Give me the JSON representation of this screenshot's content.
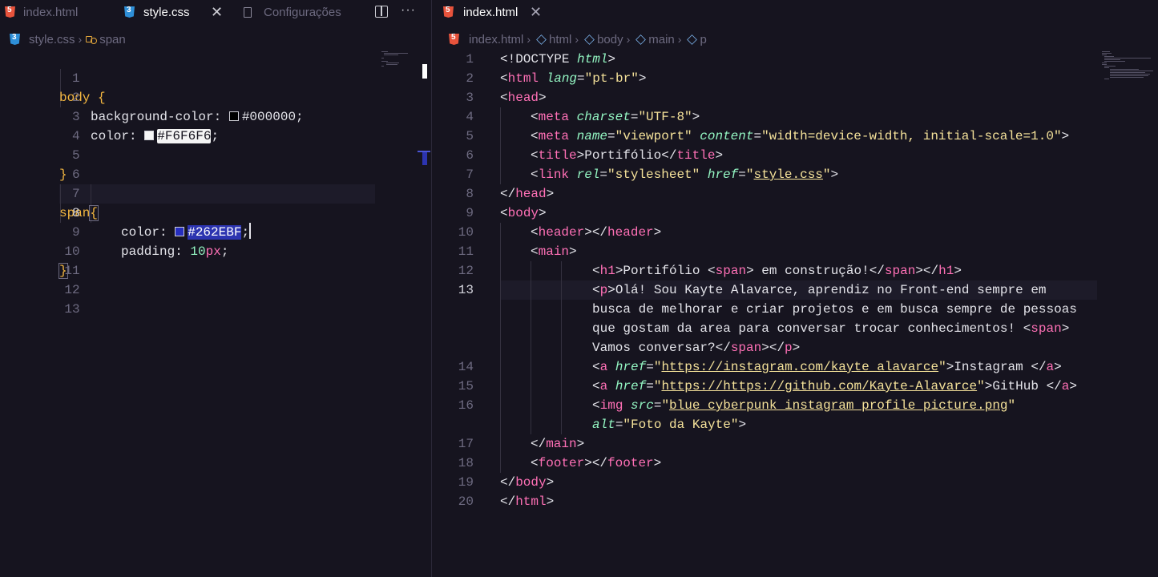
{
  "left": {
    "tabs": [
      {
        "label": "index.html",
        "icon": "html5-icon",
        "active": false
      },
      {
        "label": "style.css",
        "icon": "css3-icon",
        "active": true,
        "close": "✕"
      },
      {
        "label": "Configurações",
        "icon": "file-icon",
        "active": false
      }
    ],
    "toolbar": {
      "split_icon": "split-editor-icon",
      "more": "···"
    },
    "breadcrumb": {
      "file": "style.css",
      "symbol": "span",
      "sep": "›"
    },
    "lines": [
      {
        "n": "1"
      },
      {
        "n": "2"
      },
      {
        "n": "3"
      },
      {
        "n": "4"
      },
      {
        "n": "5"
      },
      {
        "n": "6"
      },
      {
        "n": "7"
      },
      {
        "n": "8"
      },
      {
        "n": "9"
      },
      {
        "n": "10"
      },
      {
        "n": "11"
      },
      {
        "n": "12"
      },
      {
        "n": "13"
      }
    ],
    "code": {
      "l1_sel": "body",
      "l1_brace": " {",
      "l2_prop": "background-color: ",
      "l2_val": "#000000",
      "l2_end": ";",
      "l3_prop": "color: ",
      "l3_val": "#F6F6F6",
      "l3_end": ";",
      "l5_brace": "}",
      "l7_sel": "span",
      "l7_brace": "{",
      "l8_prop": "color: ",
      "l8_val": "#262EBF",
      "l8_end": ";",
      "l9_prop": "padding: ",
      "l9_num": "10",
      "l9_unit": "px",
      "l9_end": ";",
      "l10_brace": "}"
    },
    "swatch_colors": {
      "l2": "#000000",
      "l3": "#F6F6F6",
      "l8": "#262EBF"
    }
  },
  "right": {
    "tab": {
      "label": "index.html",
      "icon": "html5-icon",
      "close": "✕"
    },
    "breadcrumb": [
      "index.html",
      "html",
      "body",
      "main",
      "p"
    ],
    "crumb_sep": "›",
    "line_numbers": [
      "1",
      "2",
      "3",
      "4",
      "5",
      "6",
      "7",
      "8",
      "9",
      "10",
      "11",
      "12",
      "13",
      "14",
      "15",
      "16",
      "17",
      "18",
      "19",
      "20"
    ],
    "code": {
      "r1a": "<!DOCTYPE ",
      "r1b": "html",
      "r1c": ">",
      "r2a": "<",
      "r2b": "html",
      "r2c": " lang",
      "r2d": "=",
      "r2e": "\"pt-br\"",
      "r2f": ">",
      "r3a": "<",
      "r3b": "head",
      "r3c": ">",
      "r4a": "<",
      "r4b": "meta",
      "r4c": " charset",
      "r4d": "=",
      "r4e": "\"UTF-8\"",
      "r4f": ">",
      "r5a": "<",
      "r5b": "meta",
      "r5c": " name",
      "r5d": "=",
      "r5e": "\"viewport\"",
      "r5f": " content",
      "r5g": "=",
      "r5h": "\"width=device-width, initial-scale=1.0\"",
      "r5i": ">",
      "r6a": "<",
      "r6b": "title",
      "r6c": ">",
      "r6d": "Portifólio",
      "r6e": "</",
      "r6f": "title",
      "r6g": ">",
      "r7a": "<",
      "r7b": "link",
      "r7c": " rel",
      "r7d": "=",
      "r7e": "\"stylesheet\"",
      "r7f": " href",
      "r7g": "=",
      "r7h": "\"",
      "r7i": "style.css",
      "r7j": "\"",
      "r7k": ">",
      "r8a": "</",
      "r8b": "head",
      "r8c": ">",
      "r9a": "<",
      "r9b": "body",
      "r9c": ">",
      "r10a": "<",
      "r10b": "header",
      "r10c": "></",
      "r10d": "header",
      "r10e": ">",
      "r11a": "<",
      "r11b": "main",
      "r11c": ">",
      "r12a": "<",
      "r12b": "h1",
      "r12c": ">",
      "r12d": "Portifólio ",
      "r12e": "<",
      "r12f": "span",
      "r12g": ">",
      "r12h": " em construção!",
      "r12i": "</",
      "r12j": "span",
      "r12k": "></",
      "r12l": "h1",
      "r12m": ">",
      "r13a": "<",
      "r13b": "p",
      "r13c": ">",
      "r13d": "Olá! Sou Kayte Alavarce, aprendiz no Front-end sempre em",
      "r13w1": "busca de melhorar e criar projetos e em busca sempre de pessoas",
      "r13w2a": "que gostam da area para conversar trocar conhecimentos! ",
      "r13w2b": "<",
      "r13w2c": "span",
      "r13w2d": ">",
      "r13w3a": "Vamos conversar?",
      "r13w3b": "</",
      "r13w3c": "span",
      "r13w3d": "></",
      "r13w3e": "p",
      "r13w3f": ">",
      "r14a": "<",
      "r14b": "a",
      "r14c": " href",
      "r14d": "=",
      "r14e": "\"",
      "r14f": "https://instagram.com/kayte_alavarce",
      "r14g": "\"",
      "r14h": ">",
      "r14i": "Instagram ",
      "r14j": "</",
      "r14k": "a",
      "r14l": ">",
      "r15a": "<",
      "r15b": "a",
      "r15c": " href",
      "r15d": "=",
      "r15e": "\"",
      "r15f": "https://https://github.com/Kayte-Alavarce",
      "r15g": "\"",
      "r15h": ">",
      "r15i": "GitHub ",
      "r15j": "</",
      "r15k": "a",
      "r15l": ">",
      "r16a": "<",
      "r16b": "img",
      "r16c": " src",
      "r16d": "=",
      "r16e": "\"",
      "r16f": "blue cyberpunk instagram profile picture.png",
      "r16g": "\"",
      "r16w1a": "alt",
      "r16w1b": "=",
      "r16w1c": "\"Foto da Kayte\"",
      "r16w1d": ">",
      "r17a": "</",
      "r17b": "main",
      "r17c": ">",
      "r18a": "<",
      "r18b": "footer",
      "r18c": "></",
      "r18d": "footer",
      "r18e": ">",
      "r19a": "</",
      "r19b": "body",
      "r19c": ">",
      "r20a": "</",
      "r20b": "html",
      "r20c": ">"
    }
  }
}
